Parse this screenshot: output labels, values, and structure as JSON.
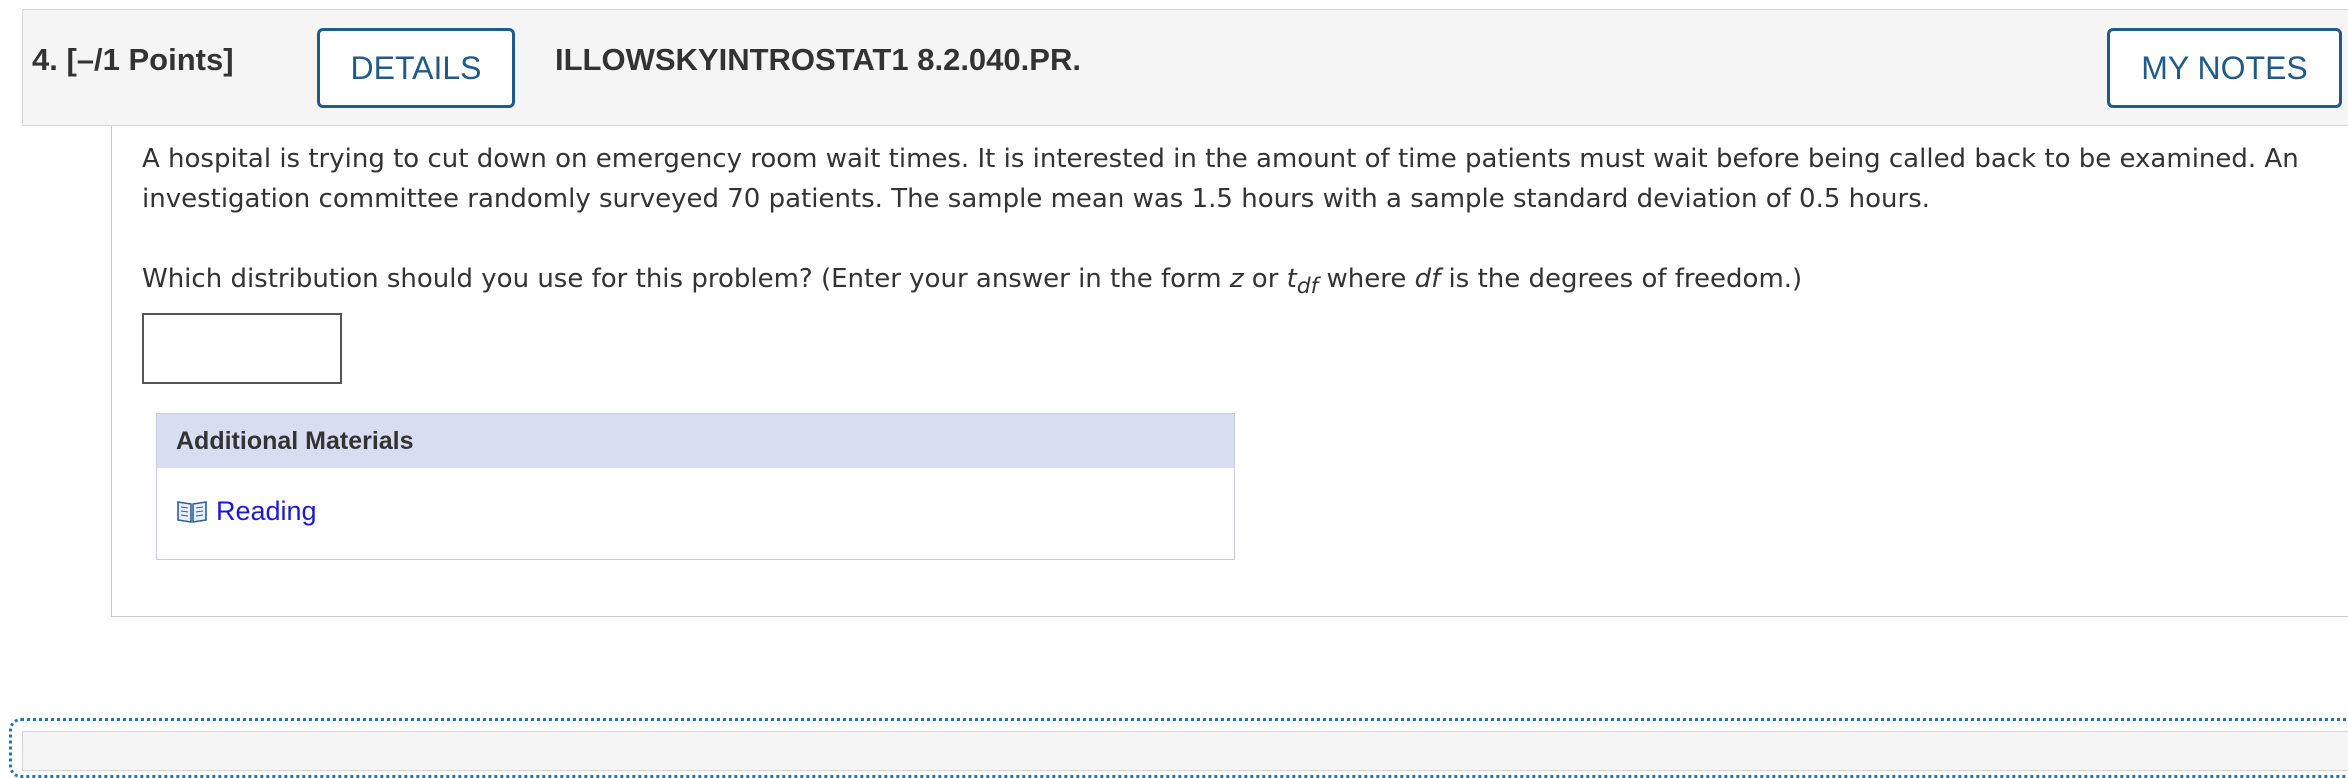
{
  "question": {
    "number_points": "4.  [–/1 Points]",
    "details_label": "DETAILS",
    "problem_code": "ILLOWSKYINTROSTAT1 8.2.040.PR.",
    "notes_label": "MY NOTES"
  },
  "body": {
    "paragraph_line1": "A hospital is trying to cut down on emergency room wait times. It is interested in the amount of time patients must wait before being called back to be examined. An",
    "paragraph_line2": "investigation committee randomly surveyed 70 patients. The sample mean was 1.5 hours with a sample standard deviation of 0.5 hours.",
    "prompt_before": "Which distribution should you use for this problem? (Enter your answer in the form ",
    "prompt_z": "z",
    "prompt_or": " or ",
    "prompt_t": "t",
    "prompt_df_sub": "df",
    "prompt_where": " where ",
    "prompt_df": "df",
    "prompt_after": " is the degrees of freedom.)",
    "answer_value": ""
  },
  "additional_materials": {
    "title": "Additional Materials",
    "link_label": "Reading"
  },
  "colors": {
    "accent": "#1f5a8a",
    "link": "#1a1ad6",
    "materials_header_bg": "#d9ddf2"
  }
}
